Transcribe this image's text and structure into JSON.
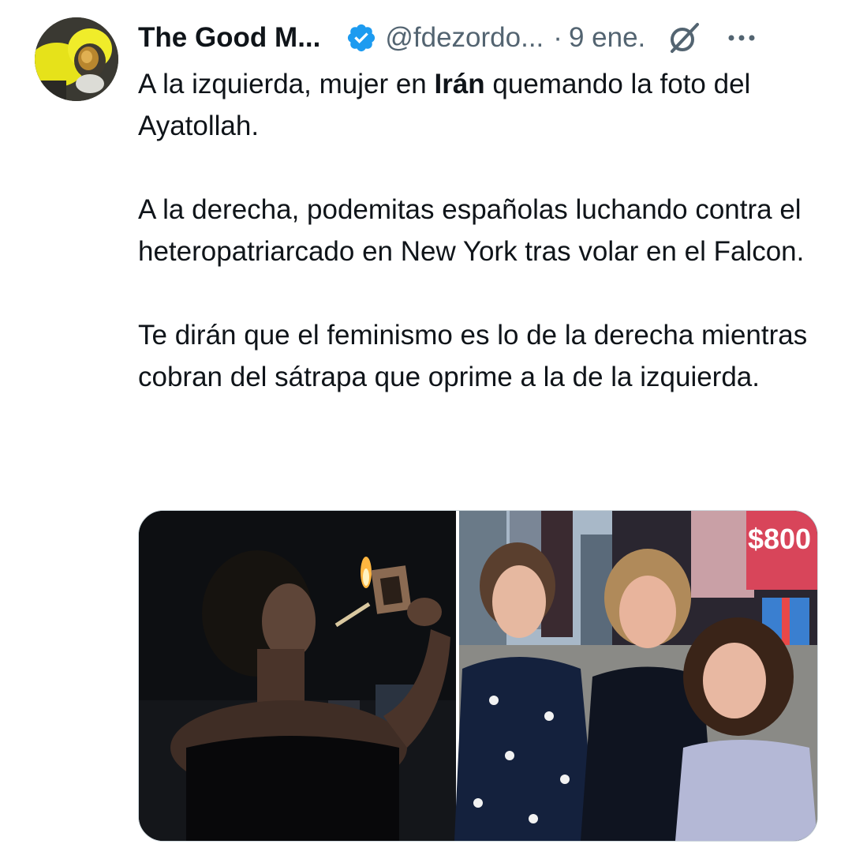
{
  "tweet": {
    "display_name": "The Good M...",
    "handle": "@fdezordo...",
    "separator": "·",
    "date": "9 ene.",
    "text_p1_a": "A la izquierda, mujer en ",
    "text_p1_bold": "Irán",
    "text_p1_b": " quemando la foto del Ayatollah.",
    "text_p2": "A la derecha, podemitas españolas luchando contra el heteropatriarcado en New York tras volar en el Falcon.",
    "text_p3": "Te dirán que el feminismo es lo de la derecha mientras cobran del sátrapa que oprime a la de la izquierda.",
    "sign_text": "$800"
  },
  "icons": {
    "verified": "verified-badge-icon",
    "grok": "grok-icon",
    "more": "more-options-icon"
  },
  "colors": {
    "verified": "#1d9bf0",
    "text": "#0f1419",
    "secondary": "#536471"
  }
}
